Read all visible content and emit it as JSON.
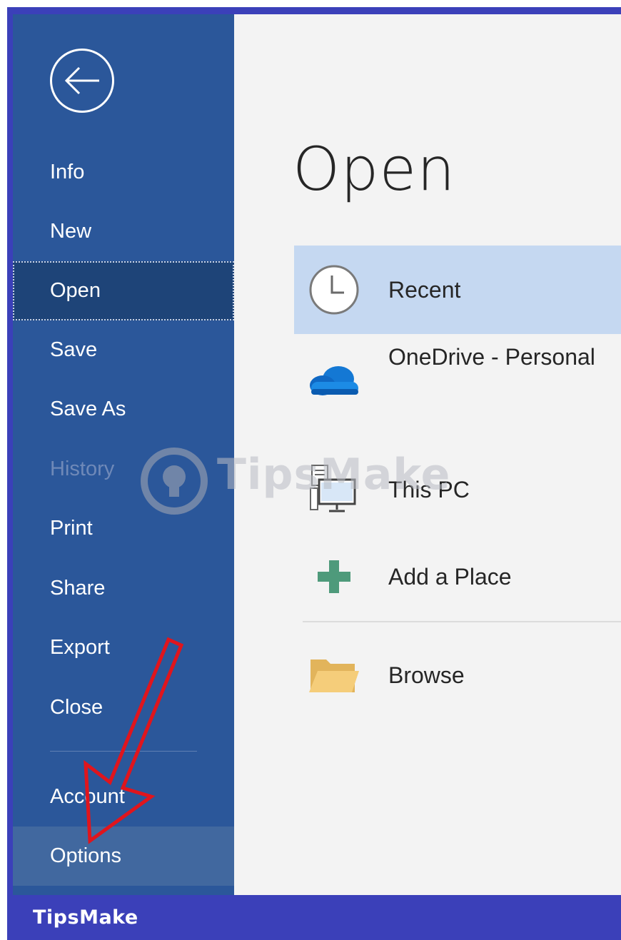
{
  "sidebar": {
    "back_icon": "arrow-left-circle-icon",
    "items": [
      {
        "label": "Info"
      },
      {
        "label": "New"
      },
      {
        "label": "Open"
      },
      {
        "label": "Save"
      },
      {
        "label": "Save As"
      },
      {
        "label": "History"
      },
      {
        "label": "Print"
      },
      {
        "label": "Share"
      },
      {
        "label": "Export"
      },
      {
        "label": "Close"
      },
      {
        "label": "Account"
      },
      {
        "label": "Options"
      }
    ],
    "active_item": "Open",
    "disabled_item": "History",
    "highlighted_item": "Options"
  },
  "main": {
    "title": "Open",
    "locations": [
      {
        "label": "Recent",
        "icon": "clock-icon",
        "selected": true
      },
      {
        "label": "OneDrive - Personal",
        "icon": "onedrive-cloud-icon"
      },
      {
        "label": "This PC",
        "icon": "computer-icon"
      },
      {
        "label": "Add a Place",
        "icon": "plus-icon"
      },
      {
        "label": "Browse",
        "icon": "folder-icon"
      }
    ]
  },
  "watermark": {
    "text": "TipsMake"
  },
  "brand": {
    "text": "TipsMake"
  },
  "colors": {
    "sidebar": "#2b579a",
    "sidebar_active": "#1e4478",
    "selected_location": "#c5d8f1",
    "frame": "#3b40b9",
    "annotation_arrow": "#e0151d"
  }
}
